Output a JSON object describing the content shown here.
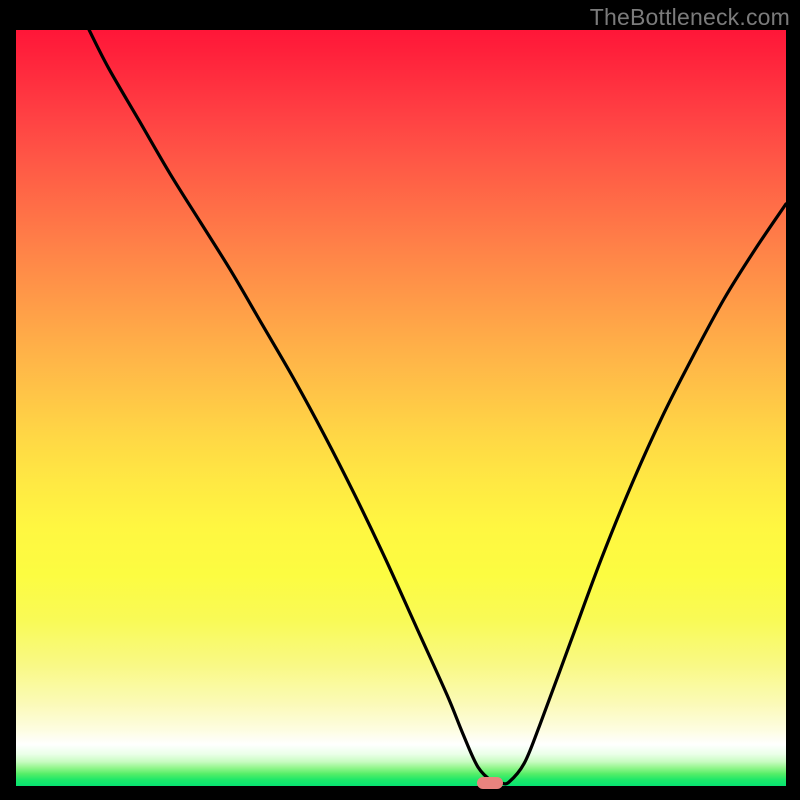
{
  "watermark": {
    "text": "TheBottleneck.com"
  },
  "marker": {
    "x_pct": 61.5,
    "y_pct": 99.6,
    "color": "#e9837e"
  },
  "chart_data": {
    "type": "line",
    "title": "",
    "xlabel": "",
    "ylabel": "",
    "xlim": [
      0,
      100
    ],
    "ylim": [
      0,
      100
    ],
    "grid": false,
    "legend": false,
    "background": "rainbow-vertical-gradient red→orange→yellow→white→green",
    "series": [
      {
        "name": "bottleneck-curve",
        "color": "#000000",
        "x": [
          9.5,
          12,
          16,
          20,
          24,
          28,
          32,
          36,
          40,
          44,
          48,
          52,
          56,
          58,
          60,
          62,
          63,
          64,
          66,
          68,
          72,
          76,
          80,
          84,
          88,
          92,
          96,
          100
        ],
        "y": [
          100,
          95,
          88,
          81,
          74.5,
          68,
          61,
          54,
          46.5,
          38.5,
          30,
          21,
          12,
          7,
          2.5,
          0.5,
          0.4,
          0.5,
          3,
          8,
          19,
          30,
          40,
          49,
          57,
          64.5,
          71,
          77
        ]
      }
    ],
    "annotations": [
      {
        "type": "pill-marker",
        "x": 61.5,
        "y": 0.4,
        "color": "#e9837e"
      }
    ]
  }
}
